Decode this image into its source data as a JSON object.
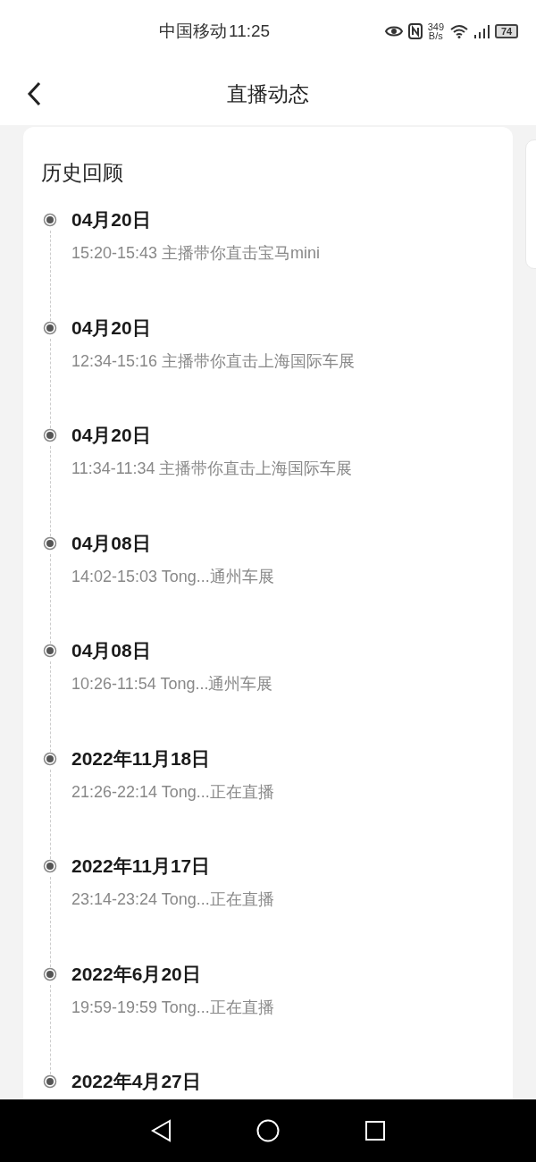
{
  "status_bar": {
    "carrier": "中国移动",
    "time": "11:25",
    "net_speed_value": "349",
    "net_speed_unit": "B/s",
    "battery": "74"
  },
  "header": {
    "title": "直播动态"
  },
  "history": {
    "title": "历史回顾",
    "items": [
      {
        "date": "04月20日",
        "detail": "15:20-15:43 主播带你直击宝马mini"
      },
      {
        "date": "04月20日",
        "detail": "12:34-15:16 主播带你直击上海国际车展"
      },
      {
        "date": "04月20日",
        "detail": "11:34-11:34 主播带你直击上海国际车展"
      },
      {
        "date": "04月08日",
        "detail": "14:02-15:03 Tong...通州车展"
      },
      {
        "date": "04月08日",
        "detail": "10:26-11:54 Tong...通州车展"
      },
      {
        "date": "2022年11月18日",
        "detail": "21:26-22:14 Tong...正在直播"
      },
      {
        "date": "2022年11月17日",
        "detail": "23:14-23:24 Tong...正在直播"
      },
      {
        "date": "2022年6月20日",
        "detail": "19:59-19:59 Tong...正在直播"
      },
      {
        "date": "2022年4月27日"
      }
    ]
  }
}
